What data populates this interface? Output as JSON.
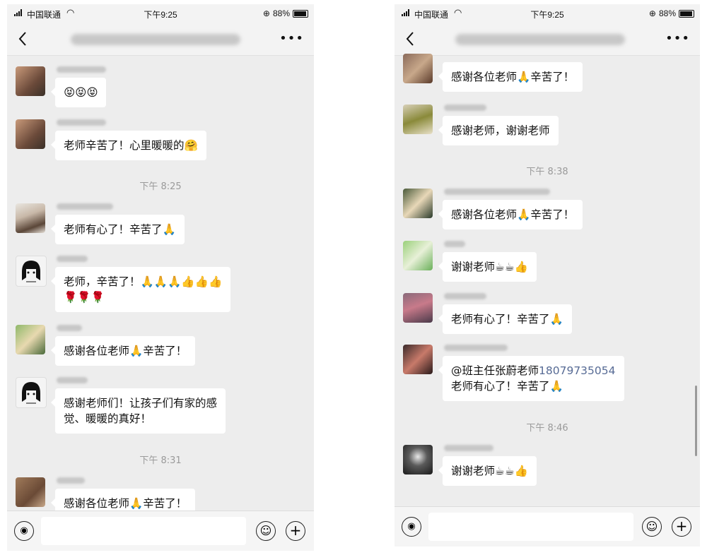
{
  "status_bar": {
    "carrier": "中国联通",
    "time": "下午9:25",
    "battery": "88%"
  },
  "left": {
    "messages": [
      {
        "text": "😝😝😝"
      },
      {
        "text": "老师辛苦了！心里暖暖的🤗"
      },
      {
        "text": "老师有心了！辛苦了🙏"
      },
      {
        "text": "老师，辛苦了！🙏🙏🙏👍👍👍\n🌹🌹🌹"
      },
      {
        "text": "感谢各位老师🙏辛苦了！"
      },
      {
        "text": "感谢老师们！让孩子们有家的感\n觉、暖暖的真好！"
      },
      {
        "text": "感谢各位老师🙏辛苦了！"
      }
    ],
    "timestamps": [
      "下午 8:25",
      "下午 8:31"
    ]
  },
  "right": {
    "messages": [
      {
        "text": "感谢各位老师🙏辛苦了！"
      },
      {
        "text": "感谢老师，谢谢老师"
      },
      {
        "text": "感谢各位老师🙏辛苦了！"
      },
      {
        "text": "谢谢老师☕☕👍"
      },
      {
        "text": "老师有心了！辛苦了🙏"
      },
      {
        "mention": "@班主任张蔚老师",
        "phone": "18079735054",
        "text2": "老师有心了！辛苦了🙏"
      },
      {
        "text": "谢谢老师☕☕👍"
      }
    ],
    "timestamps": [
      "下午 8:38",
      "下午 8:46"
    ]
  },
  "icons": {
    "back": "back-arrow-icon",
    "more": "more-options-icon",
    "voice": "voice-input-icon",
    "emoji": "emoji-icon",
    "plus": "add-attachment-icon"
  },
  "colors": {
    "background": "#ededed",
    "bubble": "#ffffff",
    "link": "#576b95",
    "timestamp": "#9a9a9a"
  }
}
